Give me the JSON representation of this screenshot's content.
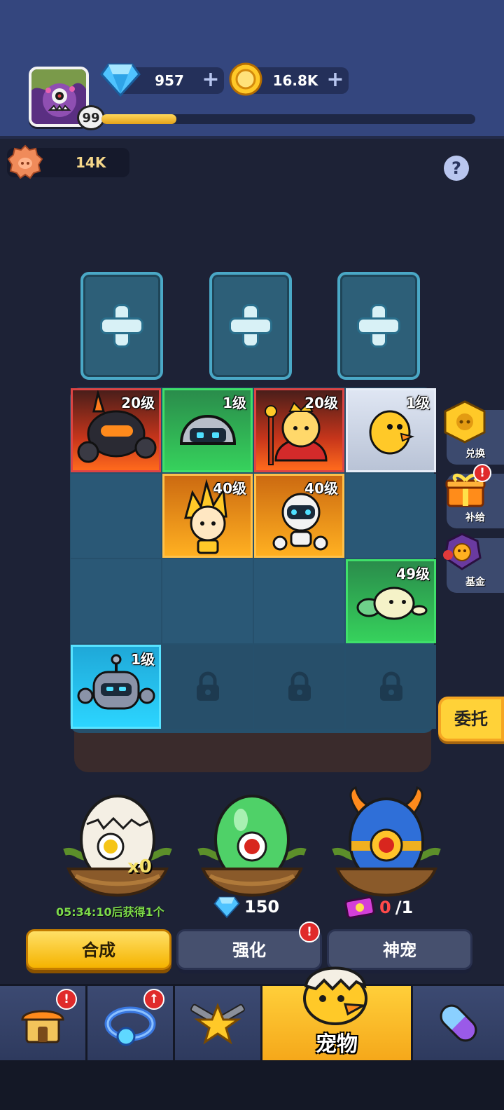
{
  "player": {
    "level": "99",
    "xp_fraction": 0.2
  },
  "currency": {
    "gems": "957",
    "gold": "16.8K",
    "pig_coins": "14K"
  },
  "help_label": "?",
  "grid": {
    "cells": [
      {
        "level": "20级",
        "tier": "red",
        "pet": "spiked-tank-pet"
      },
      {
        "level": "1级",
        "tier": "green",
        "pet": "helmet-robot-pet"
      },
      {
        "level": "20级",
        "tier": "red",
        "pet": "king-pet"
      },
      {
        "level": "1级",
        "tier": "white",
        "pet": "yellow-chick-pet"
      },
      {
        "level": "",
        "tier": "empty",
        "pet": ""
      },
      {
        "level": "40级",
        "tier": "orange",
        "pet": "spiky-hair-pet"
      },
      {
        "level": "40级",
        "tier": "orange",
        "pet": "white-robot-pet"
      },
      {
        "level": "",
        "tier": "empty",
        "pet": ""
      },
      {
        "level": "",
        "tier": "empty",
        "pet": ""
      },
      {
        "level": "",
        "tier": "empty",
        "pet": ""
      },
      {
        "level": "",
        "tier": "empty",
        "pet": ""
      },
      {
        "level": "49级",
        "tier": "green",
        "pet": "green-worm-pet"
      },
      {
        "level": "1级",
        "tier": "blue",
        "pet": "antenna-bot-pet"
      },
      {
        "level": "",
        "tier": "locked",
        "pet": ""
      },
      {
        "level": "",
        "tier": "locked",
        "pet": ""
      },
      {
        "level": "",
        "tier": "locked",
        "pet": ""
      }
    ]
  },
  "side": {
    "exchange": "兑换",
    "supply": "补给",
    "fund": "基金",
    "badge": "!",
    "entrust": "委托"
  },
  "eggs": {
    "basic_count": "x0",
    "timer_text": "05:34:10后获得1个",
    "rare_price": "150",
    "mythic_count": "0",
    "mythic_total": "/1"
  },
  "actions": {
    "merge": "合成",
    "enhance": "强化",
    "mythic": "神宠",
    "badge": "!"
  },
  "nav": {
    "active_label": "宠物",
    "badge": "!",
    "up_badge": "↑"
  },
  "colors": {
    "header_bg": "#34467e",
    "accent_gold": "#ffd238",
    "active_tab": "#f5a81a"
  }
}
